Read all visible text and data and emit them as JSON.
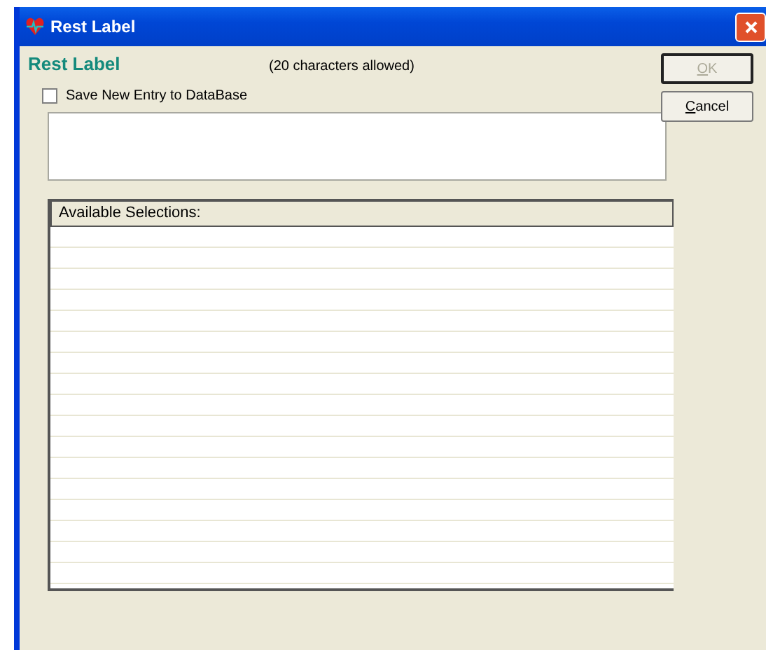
{
  "window": {
    "title": "Rest Label"
  },
  "heading": "Rest Label",
  "hint": "(20 characters allowed)",
  "save_checkbox": {
    "label": "Save New Entry to DataBase",
    "checked": false
  },
  "list": {
    "header": "Available Selections:"
  },
  "buttons": [
    {
      "label": "OK",
      "disabled": true
    },
    {
      "label": "Cancel",
      "disabled": false
    }
  ]
}
